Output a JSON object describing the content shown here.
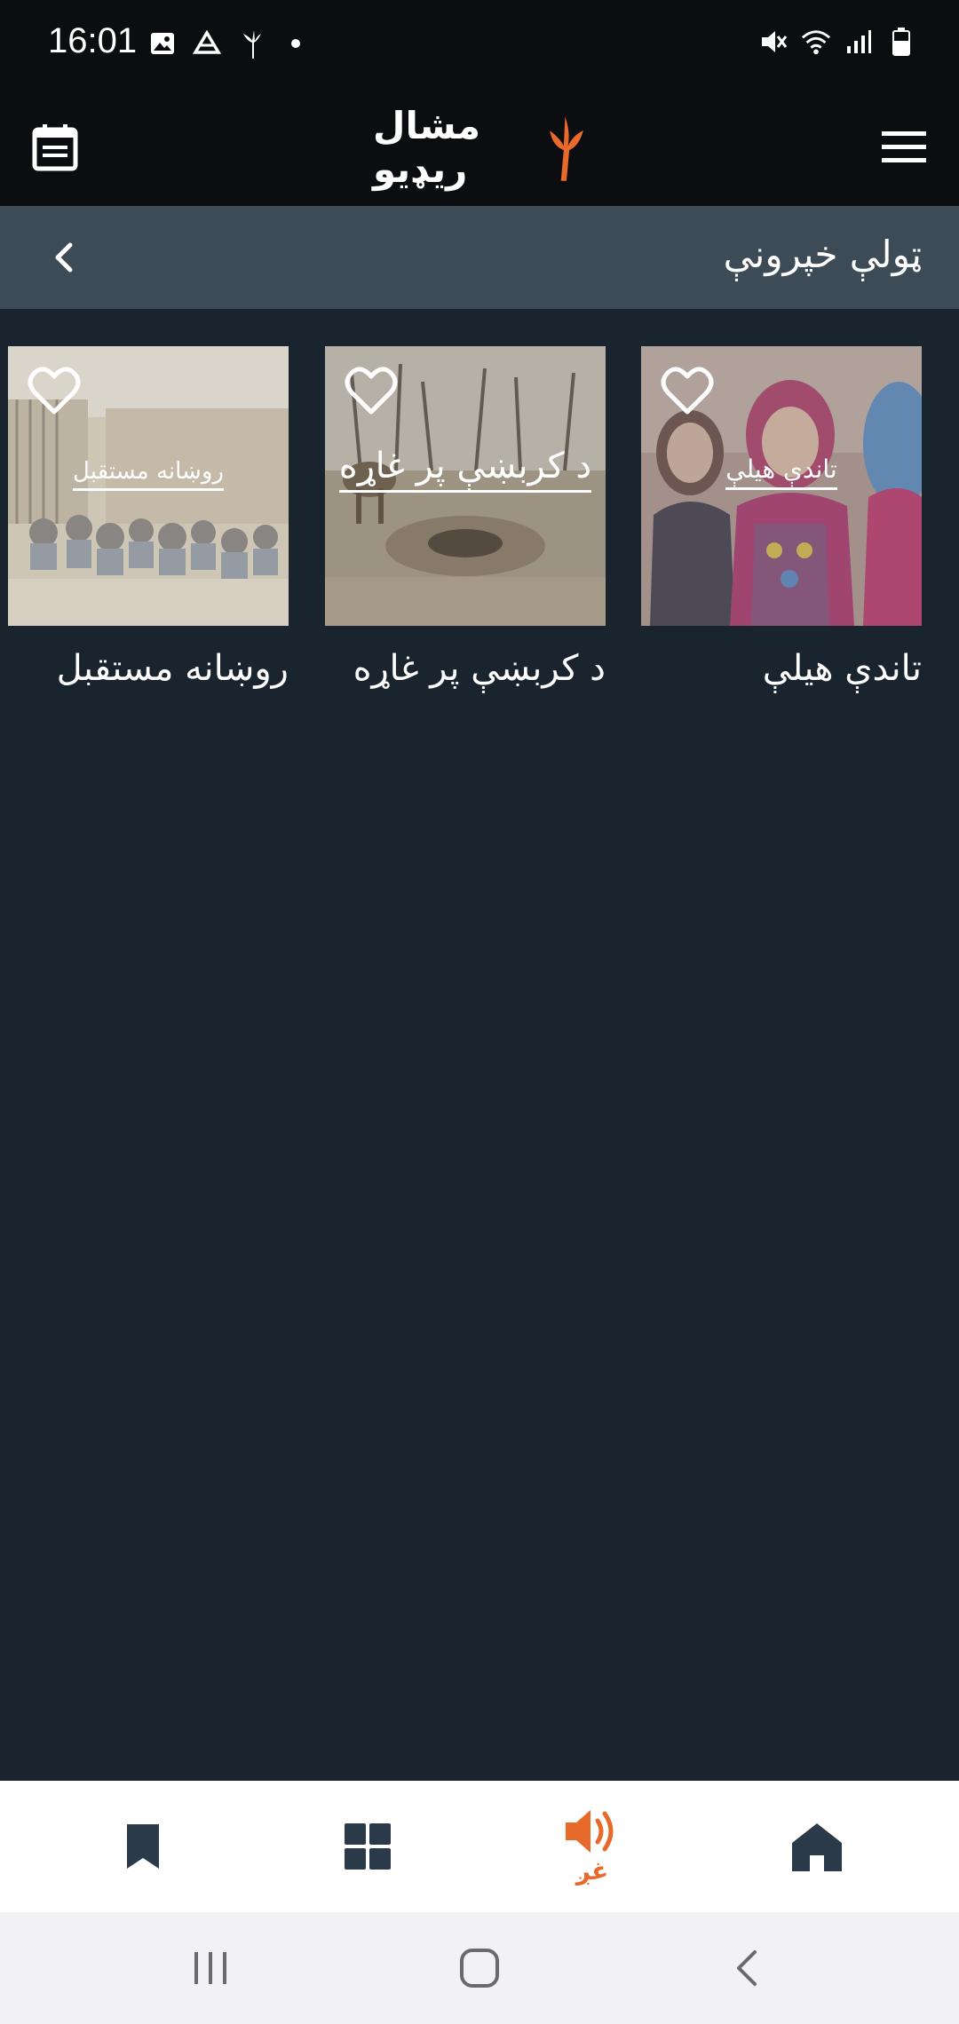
{
  "status_bar": {
    "time": "16:01",
    "left_icons": [
      "gallery-icon",
      "drive-icon",
      "radio-logo-icon",
      "dot-icon"
    ],
    "right_icons": [
      "mute-icon",
      "wifi-icon",
      "signal-icon",
      "battery-icon"
    ]
  },
  "header": {
    "logo_text": "مشال ریډیو",
    "left_icon": "schedule-icon",
    "right_icon": "menu-icon"
  },
  "section": {
    "title": "ټولې خپرونې"
  },
  "programs": [
    {
      "title": "تاندې هیلې",
      "overlay": "تاندې هیلې"
    },
    {
      "title": "د کربښې پر غاړه",
      "overlay": "د کربښې پر غاړه"
    },
    {
      "title": "روښانه مستقبل",
      "overlay": "روښانه مستقبل"
    }
  ],
  "bottom_nav": {
    "active_label": "غږ",
    "items": [
      "home-icon",
      "audio-icon",
      "grid-icon",
      "bookmark-icon"
    ]
  },
  "colors": {
    "accent": "#e86a2b",
    "background": "#19242f",
    "header": "#0b0d10",
    "section": "#3d4b57",
    "nav_icon": "#2b3a48"
  }
}
